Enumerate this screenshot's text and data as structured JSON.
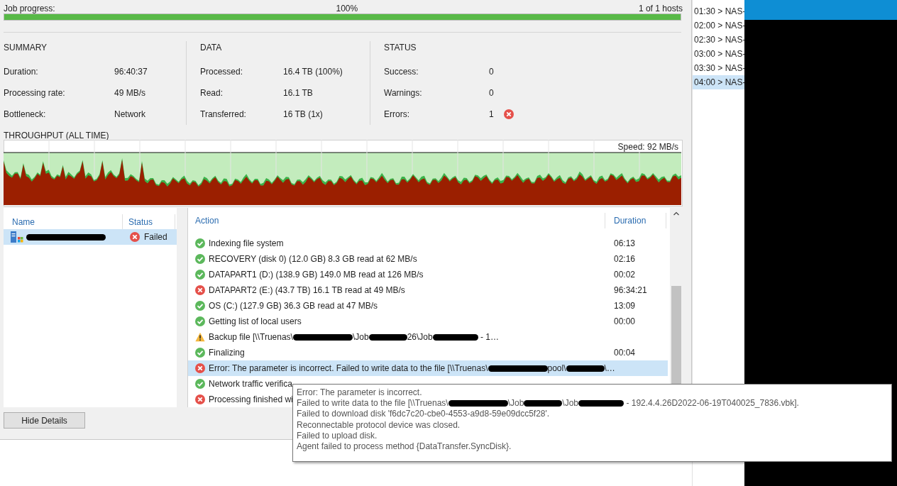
{
  "progress": {
    "label": "Job progress:",
    "percent": "100%",
    "hosts": "1 of 1 hosts",
    "level": 1
  },
  "sections": [
    {
      "title": "SUMMARY",
      "rows": [
        {
          "label": "Duration:",
          "value": "96:40:37",
          "kind": "plain"
        },
        {
          "label": "Processing rate:",
          "value": "49 MB/s",
          "kind": "plain"
        },
        {
          "label": "Bottleneck:",
          "value": "Network",
          "kind": "plain"
        }
      ]
    },
    {
      "title": "DATA",
      "rows": [
        {
          "label": "Processed:",
          "value": "16.4 TB (100%)",
          "kind": "plain"
        },
        {
          "label": "Read:",
          "value": "16.1 TB",
          "kind": "plain"
        },
        {
          "label": "Transferred:",
          "value": "16 TB (1x)",
          "kind": "plain"
        }
      ]
    },
    {
      "title": "STATUS",
      "rows": [
        {
          "label": "Success:",
          "value": "0",
          "kind": "plain"
        },
        {
          "label": "Warnings:",
          "value": "0",
          "kind": "plain"
        },
        {
          "label": "Errors:",
          "value": "1",
          "kind": "error"
        }
      ]
    }
  ],
  "throughput": {
    "title": "THROUGHPUT (ALL TIME)",
    "speed": "Speed: 92 MB/s"
  },
  "hosts": {
    "columns": [
      "Name",
      "Status"
    ],
    "rows": [
      {
        "status": "Failed",
        "kind": "error",
        "selected": true
      }
    ]
  },
  "log": {
    "columns": [
      "Action",
      "Duration"
    ],
    "rows": [
      {
        "kind": "success",
        "parts": [
          "Indexing file system"
        ],
        "duration": "06:13",
        "selected": false
      },
      {
        "kind": "success",
        "parts": [
          "RECOVERY (disk 0) (12.0 GB) 8.3 GB read at 62 MB/s"
        ],
        "duration": "02:16",
        "selected": false
      },
      {
        "kind": "success",
        "parts": [
          "DATAPART1 (D:) (138.9 GB) 149.0 MB read at 126 MB/s"
        ],
        "duration": "00:02",
        "selected": false
      },
      {
        "kind": "error",
        "parts": [
          "DATAPART2 (E:) (43.7 TB) 16.1 TB read at 49 MB/s"
        ],
        "duration": "96:34:21",
        "selected": false
      },
      {
        "kind": "success",
        "parts": [
          "OS (C:) (127.9 GB) 36.3 GB read at 47 MB/s"
        ],
        "duration": "13:09",
        "selected": false
      },
      {
        "kind": "success",
        "parts": [
          "Getting list of local users"
        ],
        "duration": "00:00",
        "selected": false
      },
      {
        "kind": "warning",
        "parts": [
          "Backup file [\\\\Truenas\\",
          "\\Job",
          "26\\Job",
          " - 1…"
        ],
        "selected": false
      },
      {
        "kind": "success",
        "parts": [
          "Finalizing"
        ],
        "duration": "00:04",
        "selected": false
      },
      {
        "kind": "error",
        "parts": [
          "Error: The parameter is incorrect. Failed to write data to the file [\\\\Truenas\\",
          "pool\\",
          "\\…"
        ],
        "selected": true
      },
      {
        "kind": "success",
        "parts": [
          "Network traffic verifica"
        ],
        "selected": false
      },
      {
        "kind": "error",
        "parts": [
          "Processing finished wi"
        ],
        "selected": false
      }
    ]
  },
  "tooltip": {
    "lines": [
      [
        "Error: The parameter is incorrect."
      ],
      [
        "Failed to write data to the file [\\\\Truenas\\",
        "\\Job",
        "\\Job",
        " - 192.4.4.26D2022-06-19T040025_7836.vbk]."
      ],
      [
        "Failed to download disk 'f6dc7c20-cbe0-4553-a9d8-59e09dcc5f28'."
      ],
      [
        "Reconnectable protocol device was closed."
      ],
      [
        "Failed to upload disk."
      ],
      [
        "Agent failed to process method {DataTransfer.SyncDisk}."
      ]
    ]
  },
  "button": "Hide Details",
  "schedule": [
    {
      "text": "01:30 > NAS-",
      "selected": false
    },
    {
      "text": "02:00 > NAS-",
      "selected": false
    },
    {
      "text": "02:30 > NAS-",
      "selected": false
    },
    {
      "text": "03:00 > NAS-",
      "selected": false
    },
    {
      "text": "03:30 > NAS-",
      "selected": false
    },
    {
      "text": "04:00 > NAS-",
      "selected": true
    }
  ]
}
